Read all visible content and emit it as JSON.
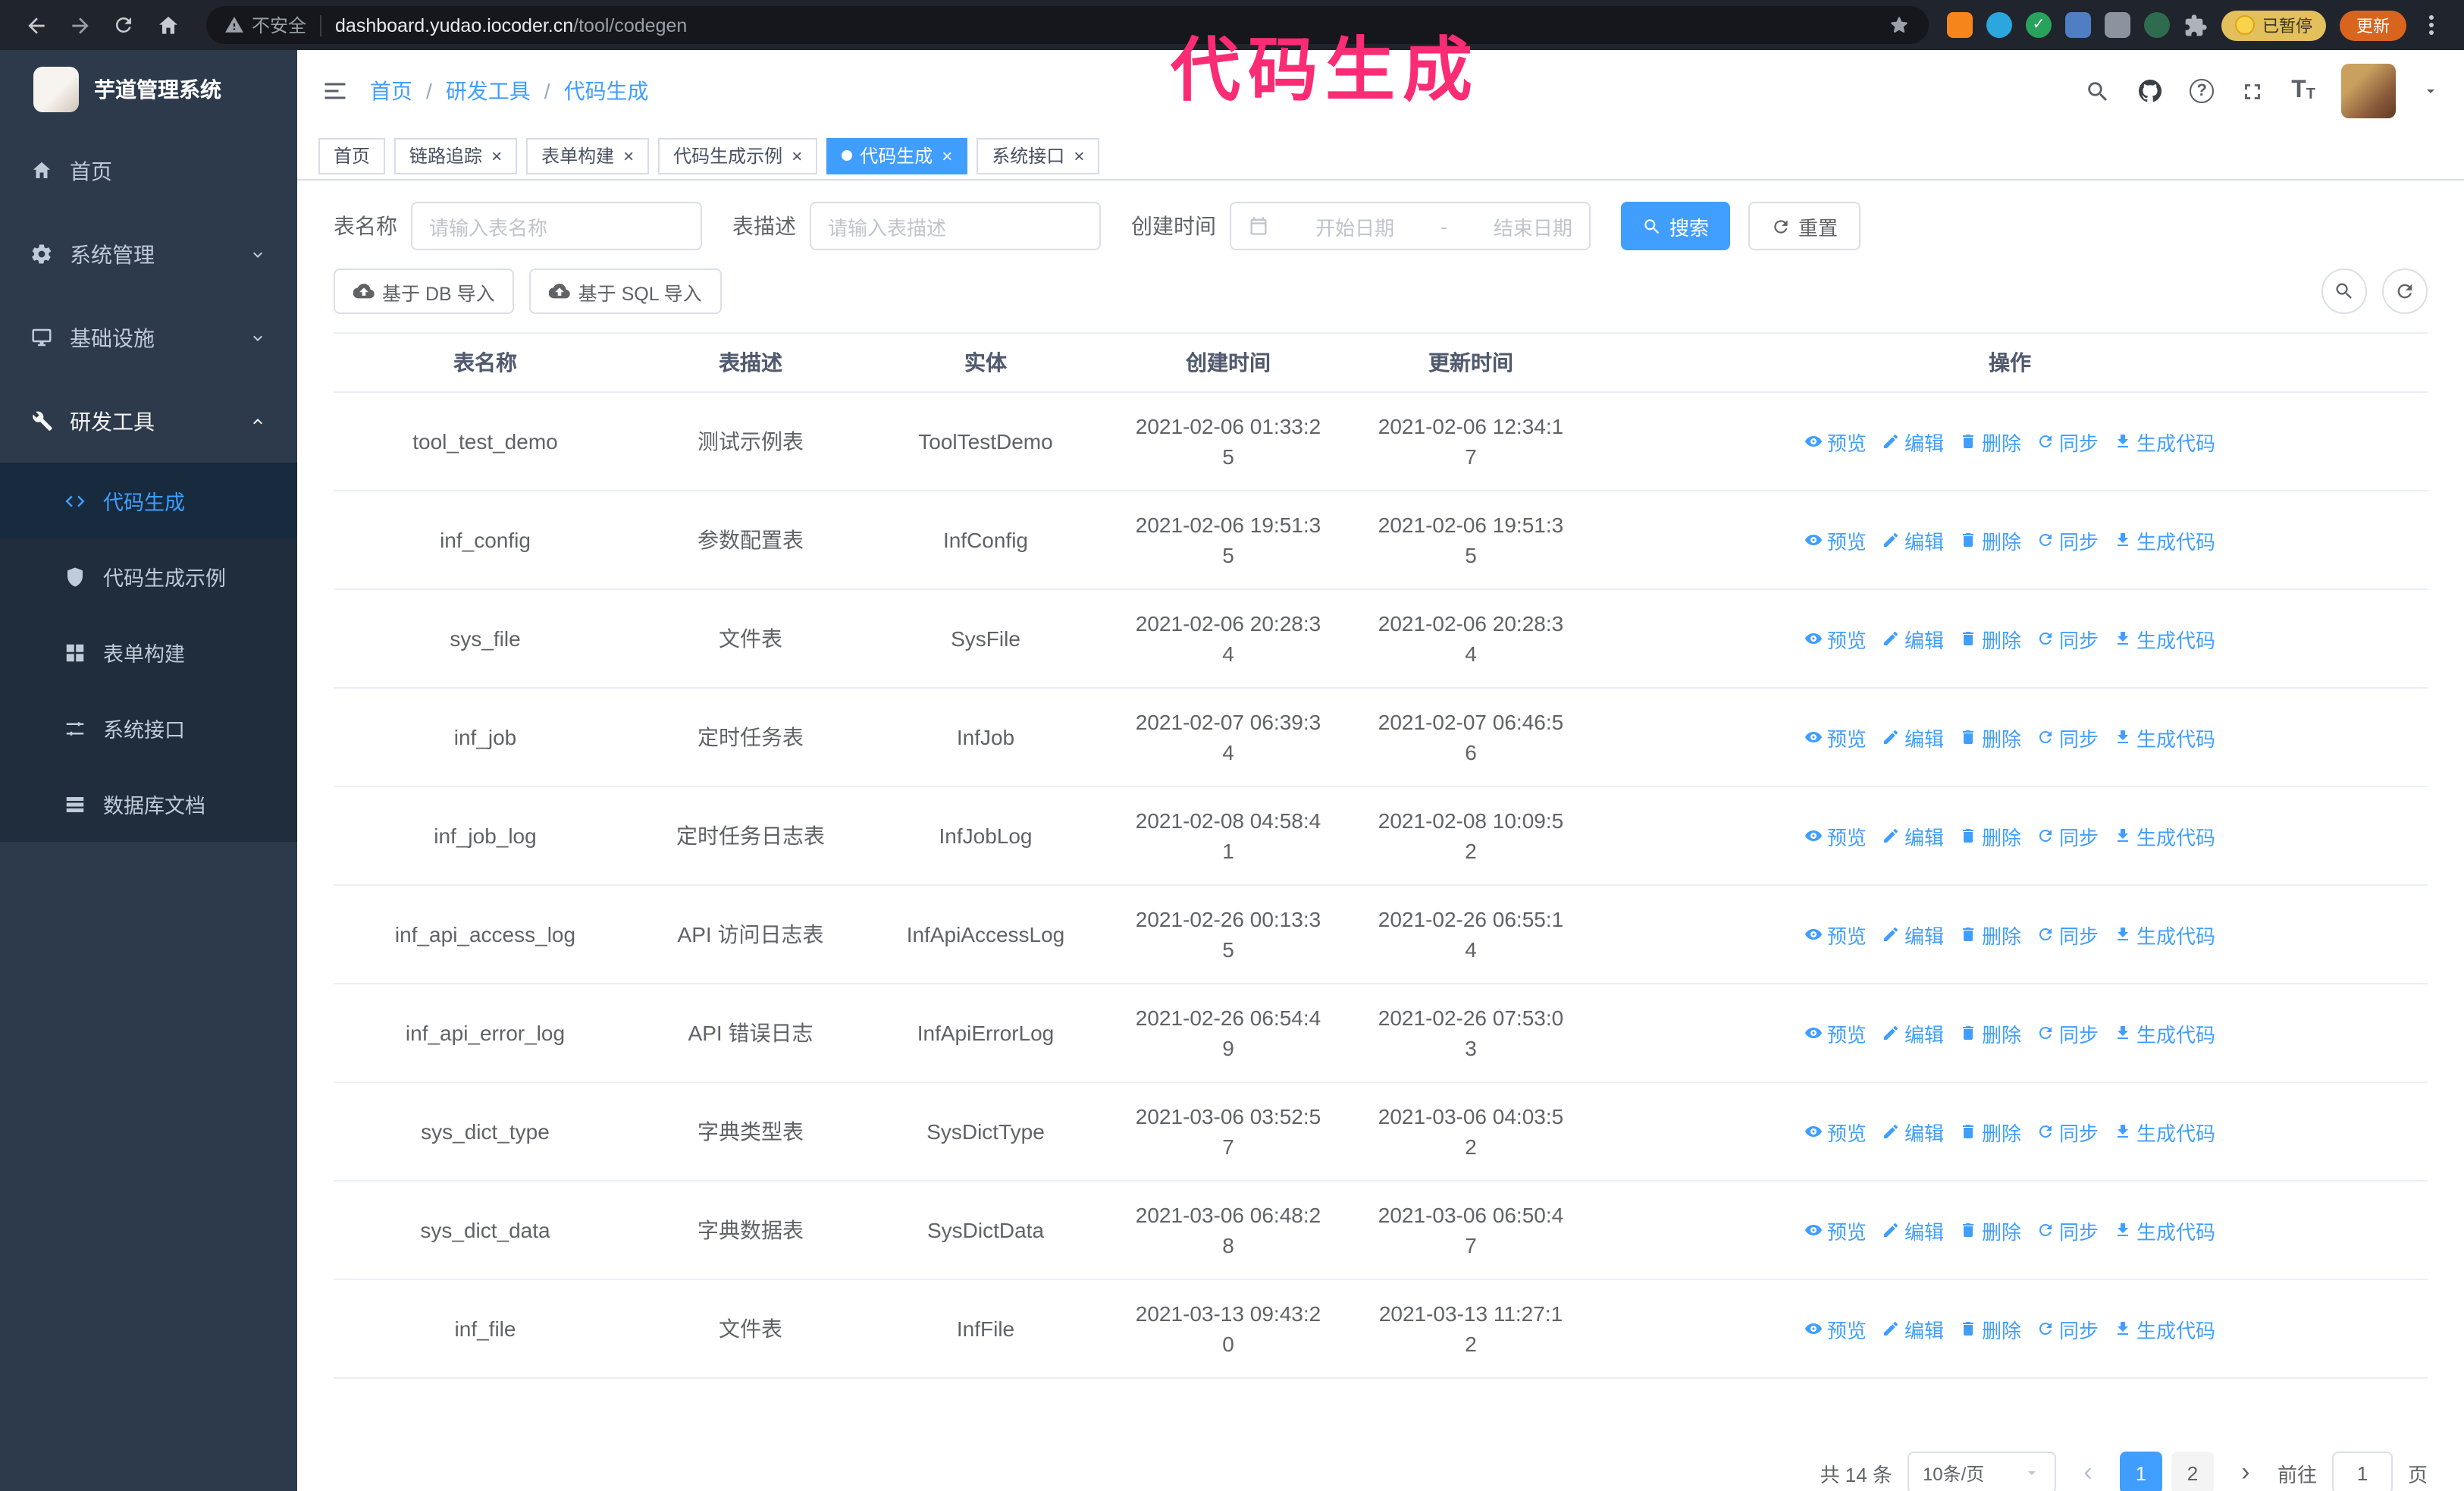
{
  "browser": {
    "security_label": "不安全",
    "url_host": "dashboard.yudao.iocoder.cn",
    "url_path": "/tool/codegen",
    "paused_badge": "已暂停",
    "update_button": "更新"
  },
  "annotation": {
    "text": "代码生成",
    "color": "#fb2b74"
  },
  "ui": {
    "breadcrumb_separator": "/",
    "tab_close": "×",
    "prev": "‹",
    "next": "›"
  },
  "sidebar": {
    "logo_title": "芋道管理系统",
    "menu": [
      {
        "label": "首页",
        "name": "home",
        "icon": "home-icon"
      },
      {
        "label": "系统管理",
        "name": "system-management",
        "icon": "gear-icon",
        "chevron": "down"
      },
      {
        "label": "基础设施",
        "name": "infrastructure",
        "icon": "monitor-icon",
        "chevron": "down"
      },
      {
        "label": "研发工具",
        "name": "dev-tools",
        "icon": "tool-icon",
        "chevron": "up",
        "expanded": true,
        "children": [
          {
            "label": "代码生成",
            "name": "codegen",
            "icon": "code-icon",
            "active": true
          },
          {
            "label": "代码生成示例",
            "name": "codegen-example",
            "icon": "shield-icon"
          },
          {
            "label": "表单构建",
            "name": "form-builder",
            "icon": "form-icon"
          },
          {
            "label": "系统接口",
            "name": "system-api",
            "icon": "api-icon"
          },
          {
            "label": "数据库文档",
            "name": "db-doc",
            "icon": "database-icon"
          }
        ]
      }
    ]
  },
  "header": {
    "breadcrumb": [
      "首页",
      "研发工具",
      "代码生成"
    ],
    "icons": [
      "search-icon",
      "github-icon",
      "help-icon",
      "fullscreen-icon",
      "font-size-icon",
      "avatar",
      "caret-down-icon"
    ]
  },
  "tabs": [
    {
      "label": "首页",
      "name": "home",
      "closable": false,
      "active": false
    },
    {
      "label": "链路追踪",
      "name": "tracing",
      "closable": true,
      "active": false
    },
    {
      "label": "表单构建",
      "name": "form-builder",
      "closable": true,
      "active": false
    },
    {
      "label": "代码生成示例",
      "name": "codegen-example",
      "closable": true,
      "active": false
    },
    {
      "label": "代码生成",
      "name": "codegen",
      "closable": true,
      "active": true
    },
    {
      "label": "系统接口",
      "name": "system-api",
      "closable": true,
      "active": false
    }
  ],
  "filters": {
    "table_name_label": "表名称",
    "table_name_placeholder": "请输入表名称",
    "table_desc_label": "表描述",
    "table_desc_placeholder": "请输入表描述",
    "created_label": "创建时间",
    "date_start_placeholder": "开始日期",
    "date_separator": "-",
    "date_end_placeholder": "结束日期",
    "search_button": "搜索",
    "reset_button": "重置"
  },
  "toolbar": {
    "import_db": "基于 DB 导入",
    "import_sql": "基于 SQL 导入"
  },
  "table": {
    "columns": [
      "表名称",
      "表描述",
      "实体",
      "创建时间",
      "更新时间",
      "操作"
    ],
    "actions": [
      {
        "label": "预览",
        "name": "preview"
      },
      {
        "label": "编辑",
        "name": "edit"
      },
      {
        "label": "删除",
        "name": "delete"
      },
      {
        "label": "同步",
        "name": "sync"
      },
      {
        "label": "生成代码",
        "name": "generate-code"
      }
    ],
    "rows": [
      {
        "name": "tool_test_demo",
        "desc": "测试示例表",
        "entity": "ToolTestDemo",
        "created": "2021-02-06 01:33:25",
        "updated": "2021-02-06 12:34:17"
      },
      {
        "name": "inf_config",
        "desc": "参数配置表",
        "entity": "InfConfig",
        "created": "2021-02-06 19:51:35",
        "updated": "2021-02-06 19:51:35"
      },
      {
        "name": "sys_file",
        "desc": "文件表",
        "entity": "SysFile",
        "created": "2021-02-06 20:28:34",
        "updated": "2021-02-06 20:28:34"
      },
      {
        "name": "inf_job",
        "desc": "定时任务表",
        "entity": "InfJob",
        "created": "2021-02-07 06:39:34",
        "updated": "2021-02-07 06:46:56"
      },
      {
        "name": "inf_job_log",
        "desc": "定时任务日志表",
        "entity": "InfJobLog",
        "created": "2021-02-08 04:58:41",
        "updated": "2021-02-08 10:09:52"
      },
      {
        "name": "inf_api_access_log",
        "desc": "API 访问日志表",
        "entity": "InfApiAccessLog",
        "created": "2021-02-26 00:13:35",
        "updated": "2021-02-26 06:55:14"
      },
      {
        "name": "inf_api_error_log",
        "desc": "API 错误日志",
        "entity": "InfApiErrorLog",
        "created": "2021-02-26 06:54:49",
        "updated": "2021-02-26 07:53:03"
      },
      {
        "name": "sys_dict_type",
        "desc": "字典类型表",
        "entity": "SysDictType",
        "created": "2021-03-06 03:52:57",
        "updated": "2021-03-06 04:03:52"
      },
      {
        "name": "sys_dict_data",
        "desc": "字典数据表",
        "entity": "SysDictData",
        "created": "2021-03-06 06:48:28",
        "updated": "2021-03-06 06:50:47"
      },
      {
        "name": "inf_file",
        "desc": "文件表",
        "entity": "InfFile",
        "created": "2021-03-13 09:43:20",
        "updated": "2021-03-13 11:27:12"
      }
    ]
  },
  "pagination": {
    "total_text": "共 14 条",
    "page_size": "10条/页",
    "pages": [
      "1",
      "2"
    ],
    "active_page": "1",
    "goto_label": "前往",
    "goto_value": "1",
    "goto_suffix": "页"
  },
  "colors": {
    "primary": "#409eff",
    "annotation": "#fb2b74",
    "sidebar": "#2d3a4b",
    "submenu": "#1f2d3d"
  }
}
